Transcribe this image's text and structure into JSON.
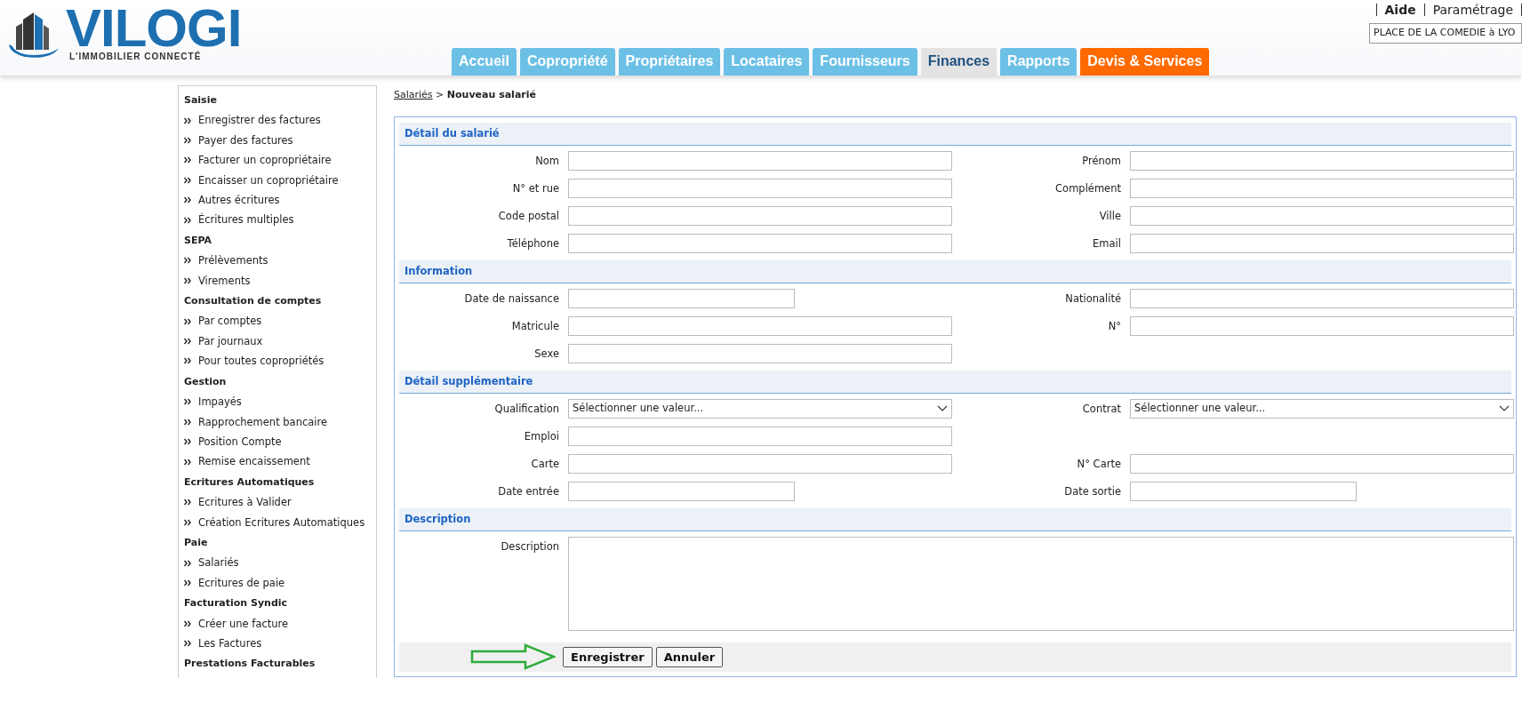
{
  "header": {
    "logo_text": "VILOGI",
    "logo_tagline": "L'IMMOBILIER CONNECTÉ",
    "top_links": [
      {
        "label": "Aide",
        "bold": true
      },
      {
        "label": "Paramétrage",
        "bold": false
      }
    ],
    "location_field": {
      "value": "PLACE DE LA COMEDIE à LYO"
    }
  },
  "tabs": [
    {
      "label": "Accueil",
      "selected": false,
      "color": "#6cc0e6"
    },
    {
      "label": "Copropriété",
      "selected": false,
      "color": "#6cc0e6"
    },
    {
      "label": "Propriétaires",
      "selected": false,
      "color": "#6cc0e6"
    },
    {
      "label": "Locataires",
      "selected": false,
      "color": "#6cc0e6"
    },
    {
      "label": "Fournisseurs",
      "selected": false,
      "color": "#6cc0e6"
    },
    {
      "label": "Finances",
      "selected": true,
      "color": "#e3e3e3"
    },
    {
      "label": "Rapports",
      "selected": false,
      "color": "#6cc0e6"
    },
    {
      "label": "Devis & Services",
      "selected": false,
      "color": "#ff6a00"
    }
  ],
  "sidebar": {
    "groups": [
      {
        "title": "Saisie",
        "items": [
          "Enregistrer des factures",
          "Payer des factures",
          "Facturer un copropriétaire",
          "Encaisser un copropriétaire",
          "Autres écritures",
          "Écritures multiples"
        ]
      },
      {
        "title": "SEPA",
        "items": [
          "Prélèvements",
          "Virements"
        ]
      },
      {
        "title": "Consultation de comptes",
        "items": [
          "Par comptes",
          "Par journaux",
          "Pour toutes copropriétés"
        ]
      },
      {
        "title": "Gestion",
        "items": [
          "Impayés",
          "Rapprochement bancaire",
          "Position Compte",
          "Remise encaissement"
        ]
      },
      {
        "title": "Ecritures Automatiques",
        "items": [
          "Ecritures à Valider",
          "Création Ecritures Automatiques"
        ]
      },
      {
        "title": "Paie",
        "items": [
          "Salariés",
          "Ecritures de paie"
        ]
      },
      {
        "title": "Facturation Syndic",
        "items": [
          "Créer une facture",
          "Les Factures"
        ]
      },
      {
        "title": "Prestations Facturables"
      }
    ]
  },
  "breadcrumb": {
    "link": "Salariés",
    "separator": ">",
    "current": "Nouveau salarié"
  },
  "form": {
    "sections": [
      {
        "title": "Détail du salarié",
        "rows": [
          {
            "left": {
              "label": "Nom",
              "kind": "text"
            },
            "right": {
              "label": "Prénom",
              "kind": "text"
            }
          },
          {
            "left": {
              "label": "N° et rue",
              "kind": "text"
            },
            "right": {
              "label": "Complément",
              "kind": "text"
            }
          },
          {
            "left": {
              "label": "Code postal",
              "kind": "text"
            },
            "right": {
              "label": "Ville",
              "kind": "text"
            }
          },
          {
            "left": {
              "label": "Téléphone",
              "kind": "text"
            },
            "right": {
              "label": "Email",
              "kind": "text"
            }
          }
        ]
      },
      {
        "title": "Information",
        "rows": [
          {
            "left": {
              "label": "Date de naissance",
              "kind": "date"
            },
            "right": {
              "label": "Nationalité",
              "kind": "text"
            }
          },
          {
            "left": {
              "label": "Matricule",
              "kind": "text"
            },
            "right": {
              "label": "N°",
              "kind": "text"
            }
          },
          {
            "left": {
              "label": "Sexe",
              "kind": "text"
            }
          }
        ]
      },
      {
        "title": "Détail supplémentaire",
        "rows": [
          {
            "left": {
              "label": "Qualification",
              "kind": "select",
              "value": "Sélectionner une valeur..."
            },
            "right": {
              "label": "Contrat",
              "kind": "select",
              "value": "Sélectionner une valeur..."
            }
          },
          {
            "left": {
              "label": "Emploi",
              "kind": "text"
            }
          },
          {
            "left": {
              "label": "Carte",
              "kind": "text"
            },
            "right": {
              "label": "N° Carte",
              "kind": "text"
            }
          },
          {
            "left": {
              "label": "Date entrée",
              "kind": "date"
            },
            "right": {
              "label": "Date sortie",
              "kind": "date"
            }
          }
        ]
      },
      {
        "title": "Description",
        "rows": [
          {
            "left": {
              "label": "Description",
              "kind": "textarea"
            }
          }
        ]
      }
    ],
    "buttons": [
      "Enregistrer",
      "Annuler"
    ]
  }
}
